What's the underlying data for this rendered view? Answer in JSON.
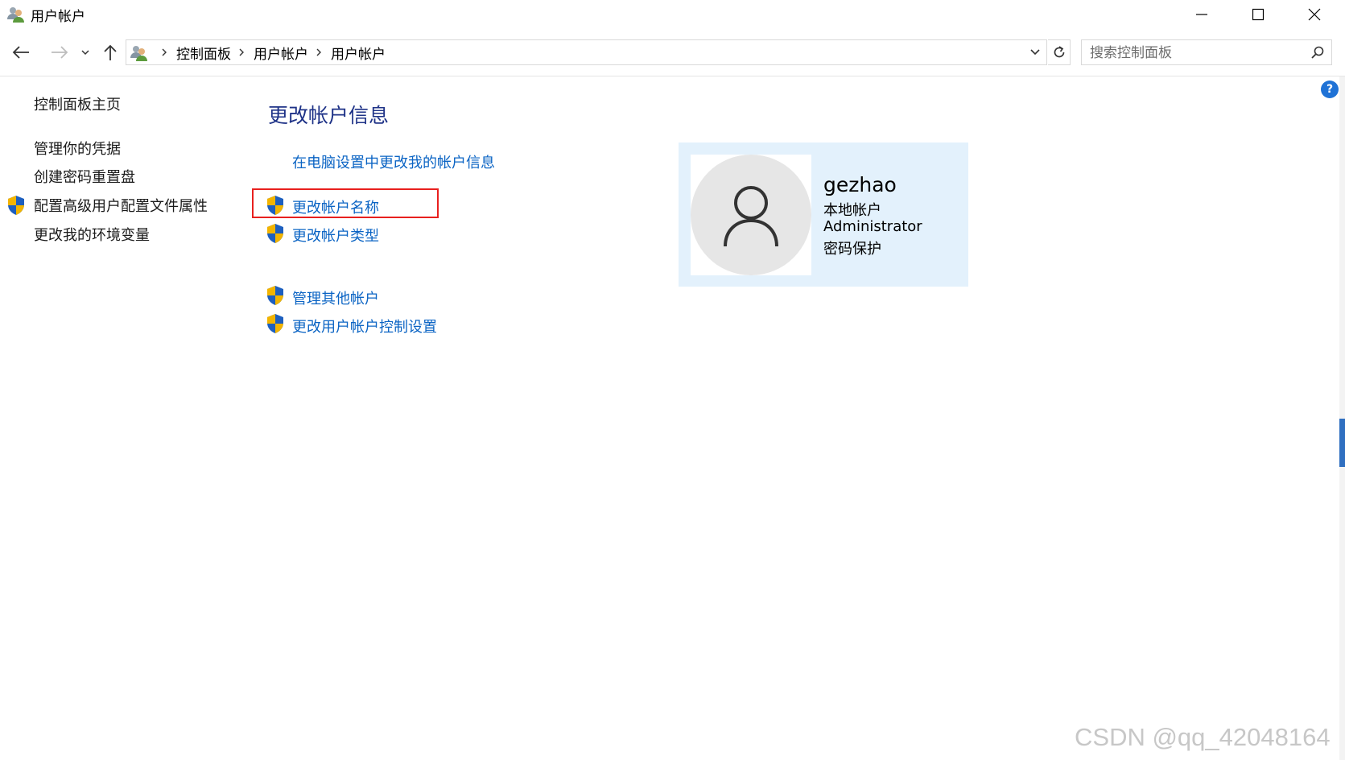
{
  "window": {
    "title": "用户帐户",
    "icon": "users-icon"
  },
  "address_bar": {
    "icon": "users-icon",
    "breadcrumbs": [
      "控制面板",
      "用户帐户",
      "用户帐户"
    ]
  },
  "search": {
    "placeholder": "搜索控制面板"
  },
  "sidebar": {
    "items": [
      {
        "label": "控制面板主页"
      },
      {
        "label": "管理你的凭据"
      },
      {
        "label": "创建密码重置盘"
      },
      {
        "label": "配置高级用户配置文件属性",
        "icon": "uac-shield-icon"
      },
      {
        "label": "更改我的环境变量"
      }
    ]
  },
  "main": {
    "title": "更改帐户信息",
    "links": [
      {
        "label": "在电脑设置中更改我的帐户信息"
      },
      {
        "label": "更改帐户名称",
        "icon": "uac-shield-icon"
      },
      {
        "label": "更改帐户类型",
        "icon": "uac-shield-icon"
      },
      {
        "label": "管理其他帐户",
        "icon": "uac-shield-icon"
      },
      {
        "label": "更改用户帐户控制设置",
        "icon": "uac-shield-icon"
      }
    ]
  },
  "account": {
    "name": "gezhao",
    "type": "本地帐户",
    "role": "Administrator",
    "protection": "密码保护",
    "avatar_icon": "user-silhouette-icon"
  },
  "help": {
    "label": "?"
  },
  "watermark": "CSDN @qq_42048164",
  "colors": {
    "link": "#0b64c4",
    "title": "#1e3287",
    "card_bg": "#e3f1fc",
    "highlight": "#e8201e"
  }
}
